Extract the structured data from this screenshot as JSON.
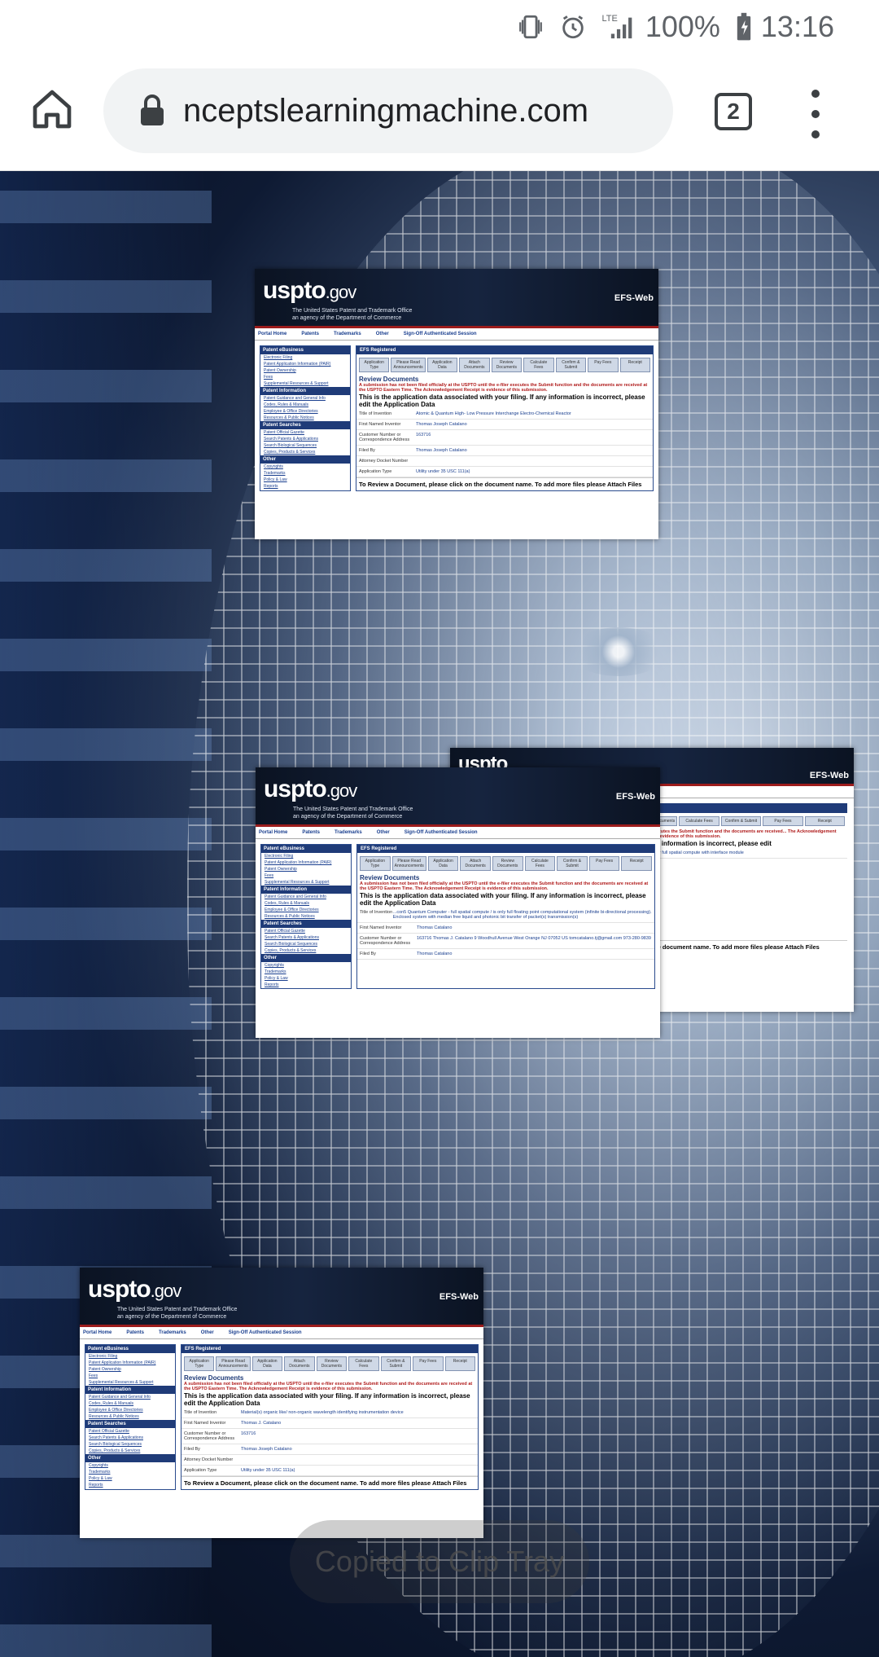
{
  "status_bar": {
    "battery": "100%",
    "time": "13:16",
    "network": "LTE",
    "icons": [
      "vibrate-icon",
      "alarm-icon",
      "signal-icon",
      "battery-icon"
    ]
  },
  "browser": {
    "url": "nceptslearningmachine.com",
    "tab_count": "2",
    "icons": [
      "home-icon",
      "lock-icon",
      "tabs-icon",
      "more-icon"
    ]
  },
  "cards": [
    {
      "logo": "uspto",
      "logo_suffix": ".gov",
      "subtitle1": "The United States Patent and Trademark Office",
      "subtitle2": "an agency of the Department of Commerce",
      "efs": "EFS-Web",
      "nav": [
        "Portal Home",
        "Patents",
        "Trademarks",
        "Other",
        "Sign-Off Authenticated Session"
      ],
      "side_h1": "Patent eBusiness",
      "side_items1": [
        "Electronic Filing",
        "Patent Application Information (PAIR)",
        "Patent Ownership",
        "Fees",
        "Supplemental Resources & Support"
      ],
      "side_h2": "Patent Information",
      "side_items2": [
        "Patent Guidance and General Info",
        "Codes, Rules & Manuals",
        "Employee & Office Directories",
        "Resources & Public Notices"
      ],
      "side_h3": "Patent Searches",
      "side_items3": [
        "Patent Official Gazette",
        "Search Patents & Applications",
        "Search Biological Sequences",
        "Copies, Products & Services"
      ],
      "side_h4": "Other",
      "side_items4": [
        "Copyrights",
        "Trademarks",
        "Policy & Law",
        "Reports"
      ],
      "main_header": "EFS Registered",
      "tabs": [
        "Application Type",
        "Please Read Announcements",
        "Application Data",
        "Attach Documents",
        "Review Documents",
        "Calculate Fees",
        "Confirm & Submit",
        "Pay Fees",
        "Receipt"
      ],
      "review_title": "Review Documents",
      "warning": "A submission has not been filed officially at the USPTO until the e-filer executes the Submit function and the documents are received at the USPTO Eastern Time. The Acknowledgement Receipt is evidence of this submission.",
      "data_title": "This is the application data associated with your filing. If any information is incorrect, please edit the Application Data",
      "rows": [
        {
          "k": "Title of Invention",
          "v": "Atomic & Quantum High- Low Pressure Interchange Electro-Chemical Reactor"
        },
        {
          "k": "First Named Inventor",
          "v": "Thomas Joseph Catalano"
        },
        {
          "k": "Customer Number or Correspondence Address",
          "v": "163716"
        },
        {
          "k": "Filed By",
          "v": "Thomas Joseph Catalano"
        },
        {
          "k": "Attorney Docket Number",
          "v": ""
        },
        {
          "k": "Application Type",
          "v": "Utility under 35 USC 111(a)"
        }
      ],
      "footer": "To Review a Document, please click on the document name. To add more files please Attach Files"
    },
    {
      "logo": "uspto",
      "logo_suffix": ".gov",
      "subtitle1": "The United States Patent and Trademark Office",
      "subtitle2": "an agency of the Department of Commerce",
      "efs": "EFS-Web",
      "nav": [
        "Portal Home",
        "Patents",
        "Trademarks",
        "Other",
        "Sign-Off Authenticated Session"
      ],
      "side_h1": "Patent eBusiness",
      "side_items1": [
        "Electronic Filing",
        "Patent Application Information (PAIR)",
        "Patent Ownership",
        "Fees",
        "Supplemental Resources & Support"
      ],
      "side_h2": "Patent Information",
      "side_items2": [
        "Patent Guidance and General Info",
        "Codes, Rules & Manuals",
        "Employee & Office Directories",
        "Resources & Public Notices"
      ],
      "side_h3": "Patent Searches",
      "side_items3": [
        "Patent Official Gazette",
        "Search Patents & Applications",
        "Search Biological Sequences",
        "Copies, Products & Services"
      ],
      "side_h4": "Other",
      "side_items4": [
        "Copyrights",
        "Trademarks",
        "Policy & Law",
        "Reports"
      ],
      "main_header": "EFS Registered",
      "tabs": [
        "Application Type",
        "Please Read Announcements",
        "Application Data",
        "Attach Documents",
        "Review Documents",
        "Calculate Fees",
        "Confirm & Submit",
        "Pay Fees",
        "Receipt"
      ],
      "review_title": "Review Documents",
      "warning": "A submission has not been filed officially at the USPTO until the e-filer executes the Submit function and the documents are received at the USPTO Eastern Time. The Acknowledgement Receipt is evidence of this submission.",
      "data_title": "This is the application data associated with your filing. If any information is incorrect, please edit the Application Data",
      "rows": [
        {
          "k": "Title of Invention",
          "v": "...con5 Quantum Computer - full spatial compute / is only full floating point computational system (infinite bi-directional processing). Enclosed system with median free liquid and photonic bit transfer of packet(s) transmission(s)"
        },
        {
          "k": "First Named Inventor",
          "v": "Thomas Catalano"
        },
        {
          "k": "Customer Number or Correspondence Address",
          "v": "163716 Thomas J. Catalano 9 Woodhull Avenue West Orange NJ 07052 US tomcatalano.tj@gmail.com 973-280-9839"
        },
        {
          "k": "Filed By",
          "v": "Thomas Catalano"
        }
      ],
      "footer": ""
    },
    {
      "logo": "uspto",
      "logo_suffix": ".gov",
      "subtitle1": "The United States Patent and Trademark Office",
      "subtitle2": "an agency of the Department of Commerce",
      "efs": "EFS-Web",
      "nav": [
        "Portal Home",
        "Patents",
        "Trademarks",
        "Other",
        "Sign-Off Authenticated Session"
      ],
      "side_h1": "Patent eBusiness",
      "side_items1": [
        "Electronic Filing",
        "Patent Application Information (PAIR)",
        "Patent Ownership",
        "Fees",
        "Supplemental Resources & Support"
      ],
      "side_h2": "Patent Information",
      "side_items2": [
        "Patent Guidance and General Info",
        "Codes, Rules & Manuals",
        "Employee & Office Directories",
        "Resources & Public Notices"
      ],
      "side_h3": "Patent Searches",
      "side_items3": [
        "Patent Official Gazette",
        "Search Patents & Applications",
        "Search Biological Sequences",
        "Copies, Products & Services"
      ],
      "side_h4": "Other",
      "side_items4": [
        "Copyrights",
        "Trademarks",
        "Policy & Law",
        "Reports"
      ],
      "main_header": "EFS Registered",
      "tabs": [
        "Application Type",
        "Please Read Announcements",
        "Application Data",
        "Attach Documents",
        "Review Documents",
        "Calculate Fees",
        "Confirm & Submit",
        "Pay Fees",
        "Receipt"
      ],
      "review_title": "Review Documents",
      "warning": "A submission has not been filed officially at the USPTO until the e-filer executes the Submit function and the documents are received at the USPTO Eastern Time. The Acknowledgement Receipt is evidence of this submission.",
      "data_title": "This is the application data associated with your filing. If any information is incorrect, please edit the Application Data",
      "rows": [
        {
          "k": "Title of Invention",
          "v": "Material(s) organic like/ non-organic wavelength identifying instrumentation device"
        },
        {
          "k": "First Named Inventor",
          "v": "Thomas J. Catalano"
        },
        {
          "k": "Customer Number or Correspondence Address",
          "v": "163716"
        },
        {
          "k": "Filed By",
          "v": "Thomas Joseph Catalano"
        },
        {
          "k": "Attorney Docket Number",
          "v": ""
        },
        {
          "k": "Application Type",
          "v": "Utility under 35 USC 111(a)"
        }
      ],
      "footer": "To Review a Document, please click on the document name. To add more files please Attach Files"
    },
    {
      "efs": "EFS-Web",
      "tabs": [
        "Review Documents",
        "Calculate Fees",
        "Confirm & Submit",
        "Pay Fees",
        "Receipt"
      ],
      "warning": "e-filer executes the Submit function and the documents are received... The Acknowledgement Receipt is evidence of this submission.",
      "data_title": "...if any information is incorrect, please edit",
      "row_v": "...processor full spatial compute with interface module",
      "footer": "...on the document name. To add more files please Attach Files"
    }
  ],
  "toast": "Copied to Clip Tray"
}
